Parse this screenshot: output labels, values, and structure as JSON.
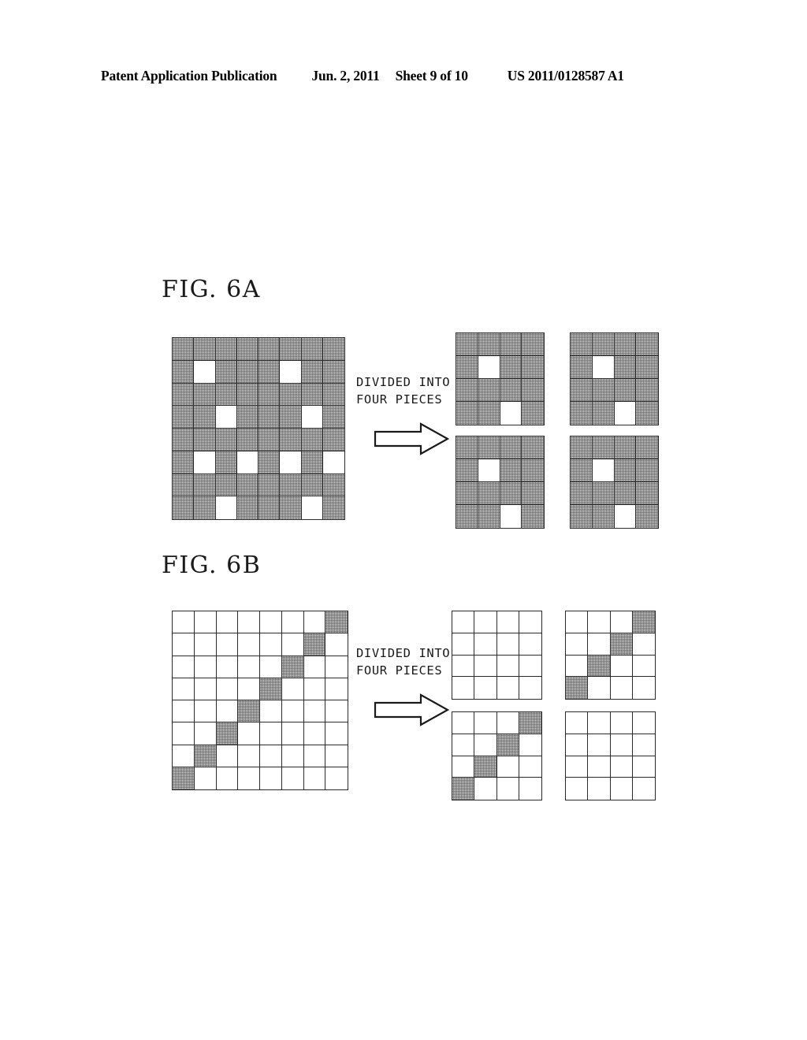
{
  "header": {
    "publication": "Patent Application Publication",
    "date": "Jun. 2, 2011",
    "sheet": "Sheet 9 of 10",
    "number": "US 2011/0128587 A1"
  },
  "colors": {
    "ink": "#1a1a1a",
    "grid_line": "#2a2a2a",
    "cell_fill": "#dedede",
    "cell_empty": "#ffffff",
    "page_background": "#ffffff"
  },
  "figures": [
    {
      "id": "fig-6a",
      "label": "FIG. 6A",
      "transition": {
        "line1": "DIVIDED INTO",
        "line2": "FOUR PIECES",
        "arrow_icon": "right-arrow-outline-icon",
        "arrow_direction": "right"
      },
      "source_grid": {
        "name": "source-grid-6a",
        "rows": 8,
        "cols": 8,
        "fill_mode": "filled-background",
        "comment": "matrix values: 1 = halftone gray cell, 0 = white cell",
        "matrix": [
          [
            1,
            1,
            1,
            1,
            1,
            1,
            1,
            1
          ],
          [
            1,
            0,
            1,
            1,
            1,
            0,
            1,
            1
          ],
          [
            1,
            1,
            1,
            1,
            1,
            1,
            1,
            1
          ],
          [
            1,
            1,
            0,
            1,
            1,
            1,
            0,
            1
          ],
          [
            1,
            1,
            1,
            1,
            1,
            1,
            1,
            1
          ],
          [
            1,
            0,
            1,
            0,
            1,
            0,
            1,
            0
          ],
          [
            1,
            1,
            1,
            1,
            1,
            1,
            1,
            1
          ],
          [
            1,
            1,
            0,
            1,
            1,
            1,
            0,
            1
          ]
        ]
      },
      "divided_grids": [
        {
          "name": "divided-grid-6a-top-left",
          "position": "top-left",
          "rows": 4,
          "cols": 4,
          "matrix": [
            [
              1,
              1,
              1,
              1
            ],
            [
              1,
              0,
              1,
              1
            ],
            [
              1,
              1,
              1,
              1
            ],
            [
              1,
              1,
              0,
              1
            ]
          ]
        },
        {
          "name": "divided-grid-6a-top-right",
          "position": "top-right",
          "rows": 4,
          "cols": 4,
          "matrix": [
            [
              1,
              1,
              1,
              1
            ],
            [
              1,
              0,
              1,
              1
            ],
            [
              1,
              1,
              1,
              1
            ],
            [
              1,
              1,
              0,
              1
            ]
          ]
        },
        {
          "name": "divided-grid-6a-bottom-left",
          "position": "bottom-left",
          "rows": 4,
          "cols": 4,
          "matrix": [
            [
              1,
              1,
              1,
              1
            ],
            [
              1,
              0,
              1,
              1
            ],
            [
              1,
              1,
              1,
              1
            ],
            [
              1,
              1,
              0,
              1
            ]
          ]
        },
        {
          "name": "divided-grid-6a-bottom-right",
          "position": "bottom-right",
          "rows": 4,
          "cols": 4,
          "matrix": [
            [
              1,
              1,
              1,
              1
            ],
            [
              1,
              0,
              1,
              1
            ],
            [
              1,
              1,
              1,
              1
            ],
            [
              1,
              1,
              0,
              1
            ]
          ]
        }
      ]
    },
    {
      "id": "fig-6b",
      "label": "FIG. 6B",
      "transition": {
        "line1": "DIVIDED INTO",
        "line2": "FOUR PIECES",
        "arrow_icon": "right-arrow-outline-icon",
        "arrow_direction": "right"
      },
      "source_grid": {
        "name": "source-grid-6b",
        "rows": 8,
        "cols": 8,
        "fill_mode": "filled-diagonal",
        "comment": "matrix values: 1 = halftone gray cell, 0 = white cell",
        "matrix": [
          [
            0,
            0,
            0,
            0,
            0,
            0,
            0,
            1
          ],
          [
            0,
            0,
            0,
            0,
            0,
            0,
            1,
            0
          ],
          [
            0,
            0,
            0,
            0,
            0,
            1,
            0,
            0
          ],
          [
            0,
            0,
            0,
            0,
            1,
            0,
            0,
            0
          ],
          [
            0,
            0,
            0,
            1,
            0,
            0,
            0,
            0
          ],
          [
            0,
            0,
            1,
            0,
            0,
            0,
            0,
            0
          ],
          [
            0,
            1,
            0,
            0,
            0,
            0,
            0,
            0
          ],
          [
            1,
            0,
            0,
            0,
            0,
            0,
            0,
            0
          ]
        ]
      },
      "divided_grids": [
        {
          "name": "divided-grid-6b-top-left",
          "position": "top-left",
          "rows": 4,
          "cols": 4,
          "matrix": [
            [
              0,
              0,
              0,
              0
            ],
            [
              0,
              0,
              0,
              0
            ],
            [
              0,
              0,
              0,
              0
            ],
            [
              0,
              0,
              0,
              0
            ]
          ]
        },
        {
          "name": "divided-grid-6b-top-right",
          "position": "top-right",
          "rows": 4,
          "cols": 4,
          "matrix": [
            [
              0,
              0,
              0,
              1
            ],
            [
              0,
              0,
              1,
              0
            ],
            [
              0,
              1,
              0,
              0
            ],
            [
              1,
              0,
              0,
              0
            ]
          ]
        },
        {
          "name": "divided-grid-6b-bottom-left",
          "position": "bottom-left",
          "rows": 4,
          "cols": 4,
          "matrix": [
            [
              0,
              0,
              0,
              1
            ],
            [
              0,
              0,
              1,
              0
            ],
            [
              0,
              1,
              0,
              0
            ],
            [
              1,
              0,
              0,
              0
            ]
          ]
        },
        {
          "name": "divided-grid-6b-bottom-right",
          "position": "bottom-right",
          "rows": 4,
          "cols": 4,
          "matrix": [
            [
              0,
              0,
              0,
              0
            ],
            [
              0,
              0,
              0,
              0
            ],
            [
              0,
              0,
              0,
              0
            ],
            [
              0,
              0,
              0,
              0
            ]
          ]
        }
      ]
    }
  ]
}
